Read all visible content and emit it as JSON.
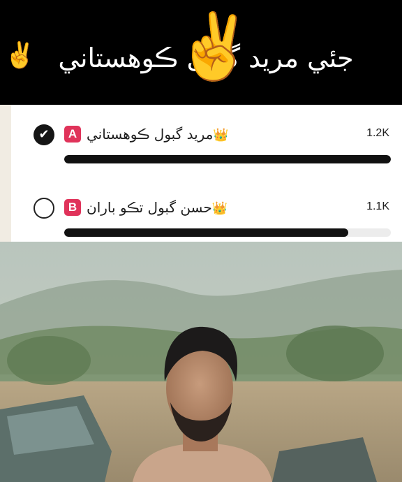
{
  "header": {
    "text": "جئي مريد گبول ڪوهستاني",
    "emoji_small": "✌️",
    "emoji_large": "✌️"
  },
  "poll": {
    "options": [
      {
        "letter": "A",
        "label": "مريد گبول ڪوهستاني",
        "crown": "👑",
        "count": "1.2K",
        "selected": true,
        "fraction": 1.0
      },
      {
        "letter": "B",
        "label": "حسن گبول تڪو باران",
        "crown": "👑",
        "count": "1.1K",
        "selected": false,
        "fraction": 0.87
      }
    ],
    "check_glyph": "✔"
  },
  "colors": {
    "letter_badge": "#e0335a",
    "bar_fill": "#111111",
    "bar_track": "#ececec"
  }
}
